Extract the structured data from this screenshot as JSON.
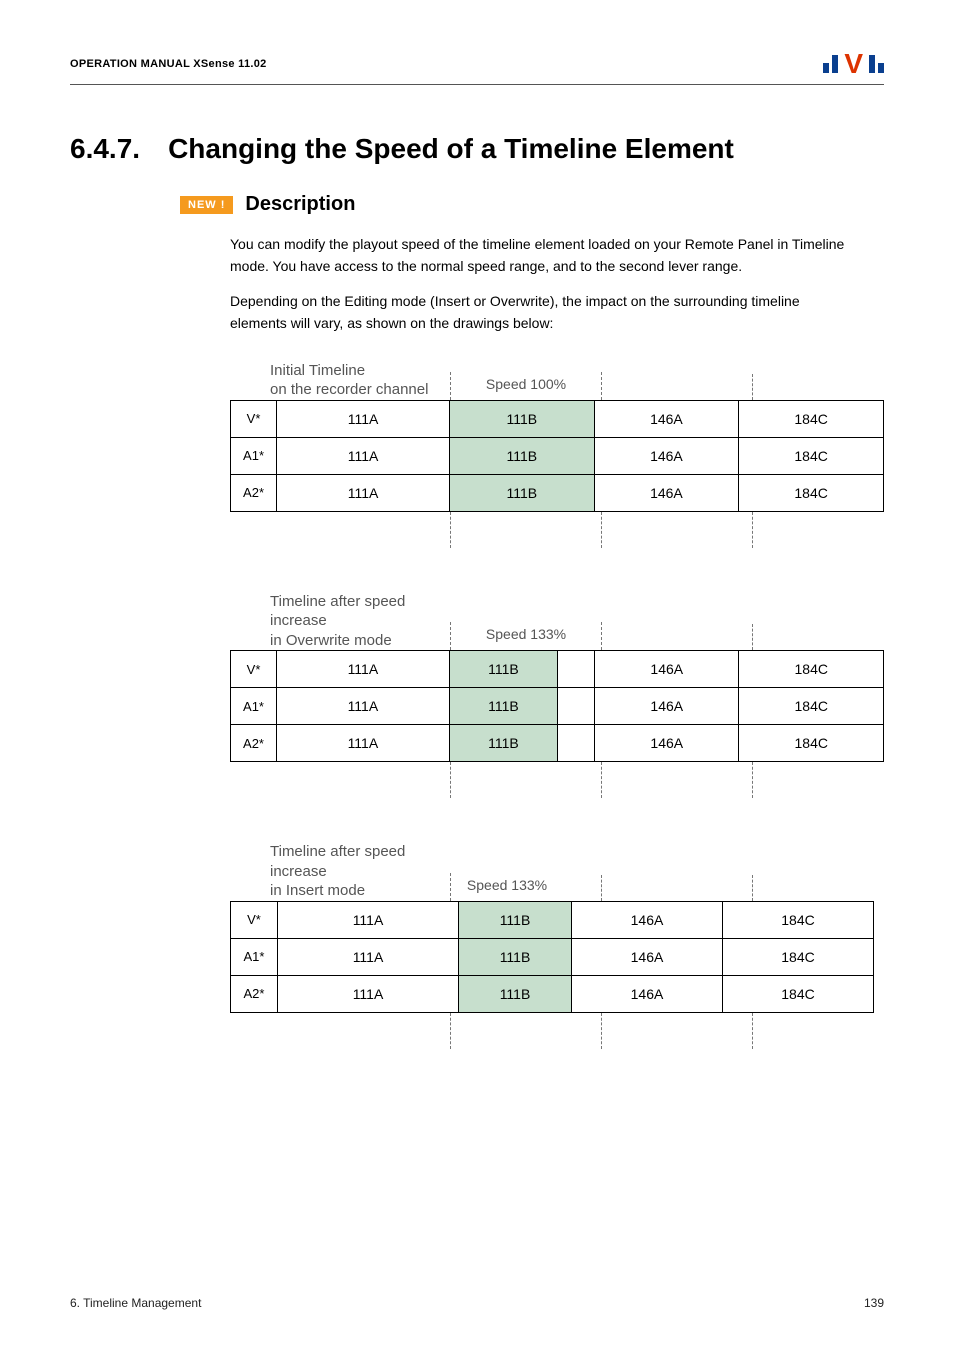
{
  "header": {
    "manual_title": "OPERATION MANUAL  XSense 11.02"
  },
  "section": {
    "number": "6.4.7.",
    "title": "Changing the Speed of a Timeline Element"
  },
  "badge": {
    "text": "NEW !"
  },
  "subheading": "Description",
  "paragraphs": {
    "p1": "You can modify the playout speed of the timeline element loaded on your Remote Panel in Timeline mode. You have access to the normal speed range, and to the second lever range.",
    "p2": "Depending on the Editing mode (Insert or Overwrite), the impact on the surrounding timeline elements will vary, as shown on the drawings below:"
  },
  "diagrams": {
    "initial": {
      "label_line1": "Initial Timeline",
      "label_line2": "on the recorder channel",
      "speed_label": "Speed 100%",
      "tracks": [
        "V*",
        "A1*",
        "A2*"
      ],
      "clips": {
        "c1": "111A",
        "c2": "111B",
        "c3": "146A",
        "c4": "184C"
      }
    },
    "overwrite": {
      "label_line1": "Timeline after speed increase",
      "label_line2": "in Overwrite mode",
      "speed_label": "Speed 133%",
      "tracks": [
        "V*",
        "A1*",
        "A2*"
      ],
      "clips": {
        "c1": "111A",
        "c2": "111B",
        "c3": "146A",
        "c4": "184C"
      }
    },
    "insert": {
      "label_line1": "Timeline after speed increase",
      "label_line2": "in Insert mode",
      "speed_label": "Speed 133%",
      "tracks": [
        "V*",
        "A1*",
        "A2*"
      ],
      "clips": {
        "c1": "111A",
        "c2": "111B",
        "c3": "146A",
        "c4": "184C"
      }
    }
  },
  "footer": {
    "left": "6. Timeline Management",
    "right": "139"
  }
}
